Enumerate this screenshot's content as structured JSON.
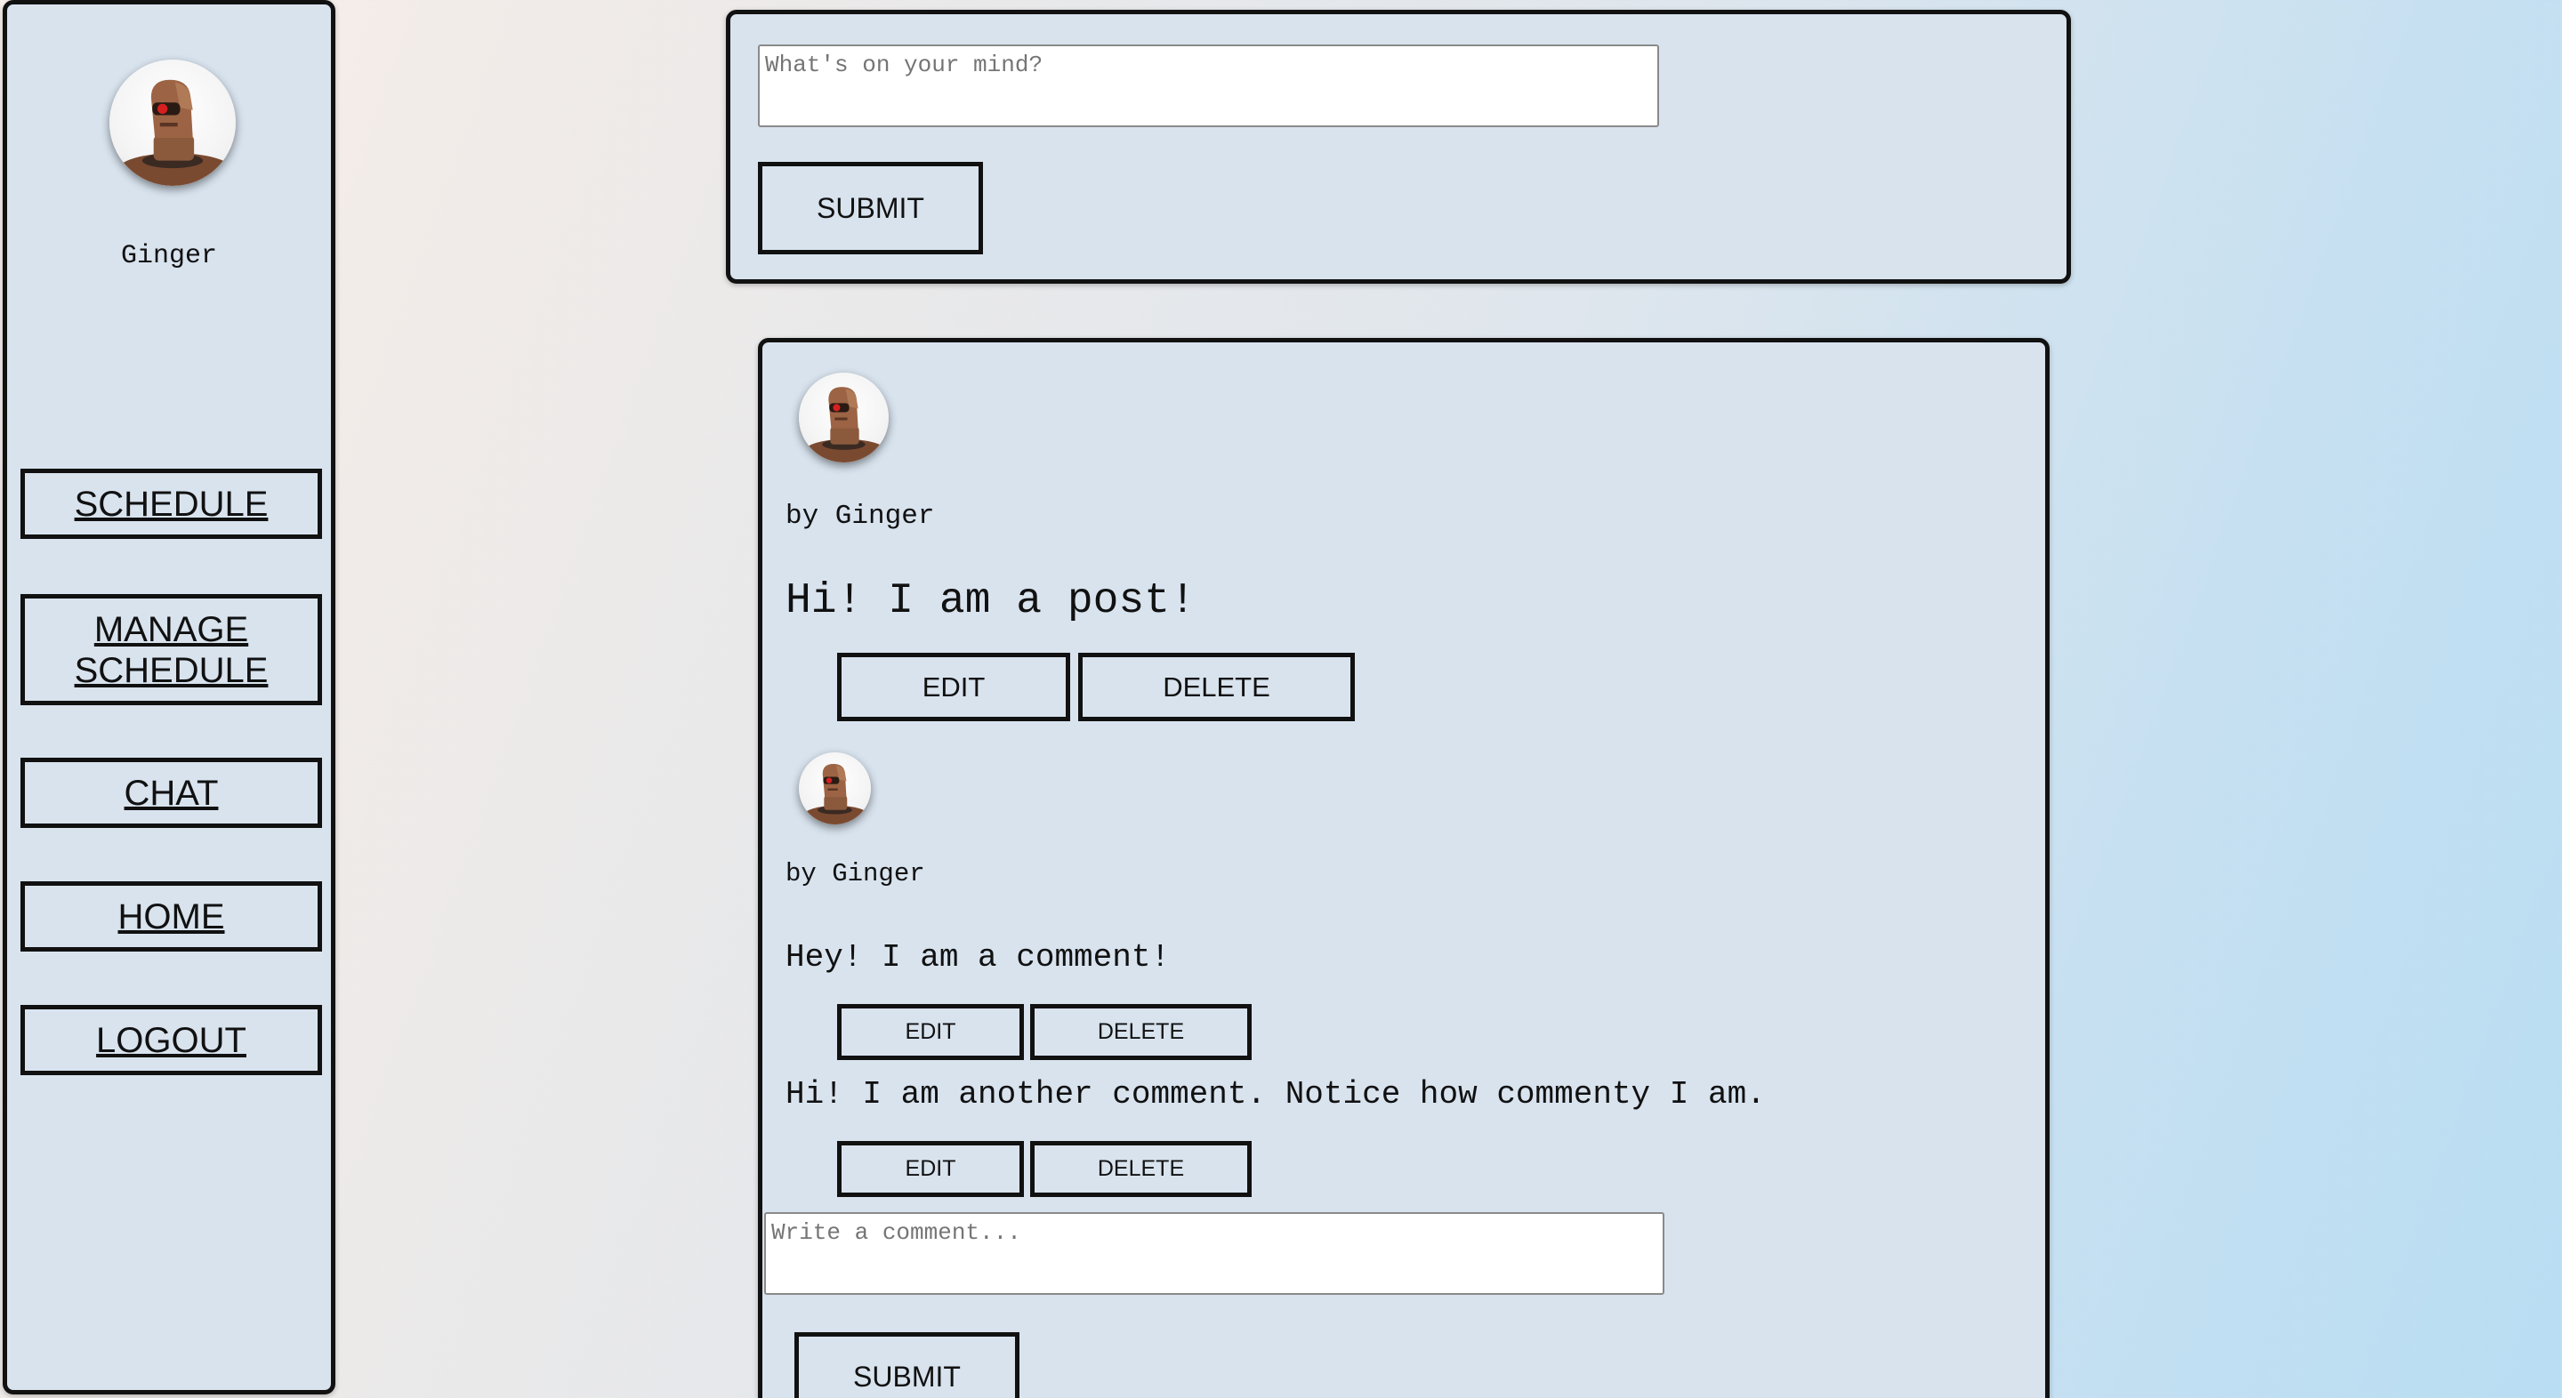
{
  "user": {
    "name": "Ginger",
    "avatar_icon": "robot-avatar-icon"
  },
  "sidebar": {
    "items": [
      {
        "label": "SCHEDULE"
      },
      {
        "label": "MANAGE SCHEDULE"
      },
      {
        "label": "CHAT"
      },
      {
        "label": "HOME"
      },
      {
        "label": "LOGOUT"
      }
    ]
  },
  "composer": {
    "placeholder": "What's on your mind?",
    "submit_label": "SUBMIT"
  },
  "post": {
    "byline": "by Ginger",
    "body": "Hi! I am a post!",
    "edit_label": "EDIT",
    "delete_label": "DELETE",
    "comments_author_byline": "by Ginger",
    "comments": [
      {
        "text": "Hey! I am a comment!",
        "edit_label": "EDIT",
        "delete_label": "DELETE"
      },
      {
        "text": "Hi! I am another comment. Notice how commenty I am.",
        "edit_label": "EDIT",
        "delete_label": "DELETE"
      }
    ],
    "comment_input": {
      "placeholder": "Write a comment..."
    },
    "comment_submit_label": "SUBMIT"
  },
  "colors": {
    "panel": "#d8e3ee",
    "border": "#111111",
    "robot_body": "#8b5a3c",
    "robot_eye": "#d62020"
  }
}
